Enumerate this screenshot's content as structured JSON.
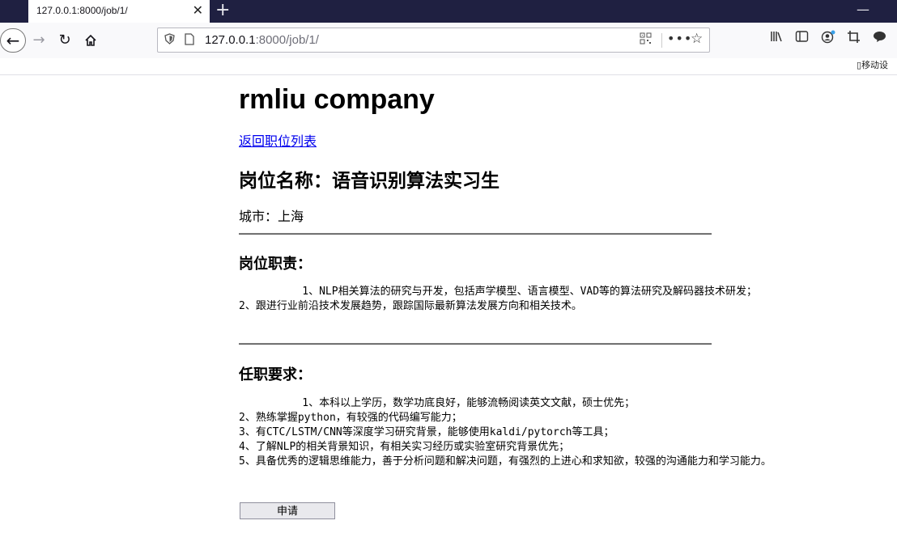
{
  "browser": {
    "tab_title": "127.0.0.1:8000/job/1/",
    "tab_close": "✕",
    "new_tab": "+",
    "minimize": "—",
    "url_host": "127.0.0.1",
    "url_path": ":8000/job/1/",
    "mobile_label": "移动设"
  },
  "page": {
    "company": "rmliu company",
    "back_link": "返回职位列表",
    "job_title": "岗位名称：语音识别算法实习生",
    "city": "城市：上海",
    "duties_heading": "岗位职责：",
    "duties_text": "          1、NLP相关算法的研究与开发，包括声学模型、语言模型、VAD等的算法研究及解码器技术研发；\n2、跟进行业前沿技术发展趋势，跟踪国际最新算法发展方向和相关技术。",
    "requirements_heading": "任职要求：",
    "requirements_text": "          1、本科以上学历，数学功底良好，能够流畅阅读英文文献，硕士优先；\n2、熟练掌握python，有较强的代码编写能力；\n3、有CTC/LSTM/CNN等深度学习研究背景，能够使用kaldi/pytorch等工具；\n4、了解NLP的相关背景知识，有相关实习经历或实验室研究背景优先；\n5、具备优秀的逻辑思维能力，善于分析问题和解决问题，有强烈的上进心和求知欲，较强的沟通能力和学习能力。",
    "apply_button": "申请"
  }
}
